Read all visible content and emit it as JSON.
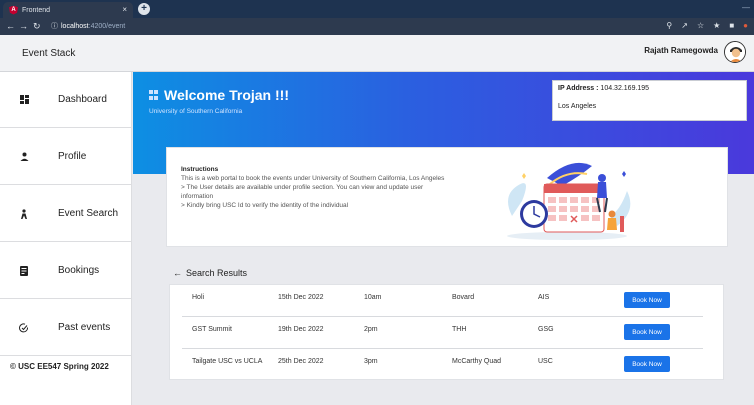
{
  "browser": {
    "tab_title": "Frontend",
    "favicon_letter": "A",
    "close_glyph": "×",
    "new_tab_glyph": "+",
    "url_host": "localhost",
    "url_path": ":4200/event"
  },
  "header": {
    "brand": "Event Stack",
    "user_name": "Rajath Ramegowda"
  },
  "sidebar": {
    "items": [
      {
        "label": "Dashboard",
        "icon": "dashboard-icon"
      },
      {
        "label": "Profile",
        "icon": "profile-icon"
      },
      {
        "label": "Event Search",
        "icon": "event-search-icon"
      },
      {
        "label": "Bookings",
        "icon": "bookings-icon"
      },
      {
        "label": "Past events",
        "icon": "past-events-icon"
      }
    ],
    "footer": "© USC EE547 Spring 2022"
  },
  "hero": {
    "title": "Welcome Trojan !!!",
    "subtitle": "University of Southern California"
  },
  "ip": {
    "label": "IP Address :",
    "value": "104.32.169.195",
    "city": "Los Angeles"
  },
  "instructions": {
    "title": "Instructions",
    "lines": [
      "This is a web portal to book the events under University of Southern California, Los Angeles",
      "> The User details are available under profile section. You can view and update user",
      "information",
      "> Kindly bring USC Id to verify the identity of the individual"
    ]
  },
  "results": {
    "heading": "Search Results",
    "button_label": "Book Now",
    "rows": [
      {
        "name": "Holi",
        "date": "15th Dec 2022",
        "time": "10am",
        "venue": "Bovard",
        "org": "AIS"
      },
      {
        "name": "GST Summit",
        "date": "19th Dec 2022",
        "time": "2pm",
        "venue": "THH",
        "org": "GSG"
      },
      {
        "name": "Tailgate USC vs UCLA",
        "date": "25th Dec 2022",
        "time": "3pm",
        "venue": "McCarthy Quad",
        "org": "USC"
      }
    ]
  },
  "colors": {
    "accent": "#1a73e8",
    "hero_start": "#0d8fe3",
    "hero_end": "#4a39dc"
  }
}
